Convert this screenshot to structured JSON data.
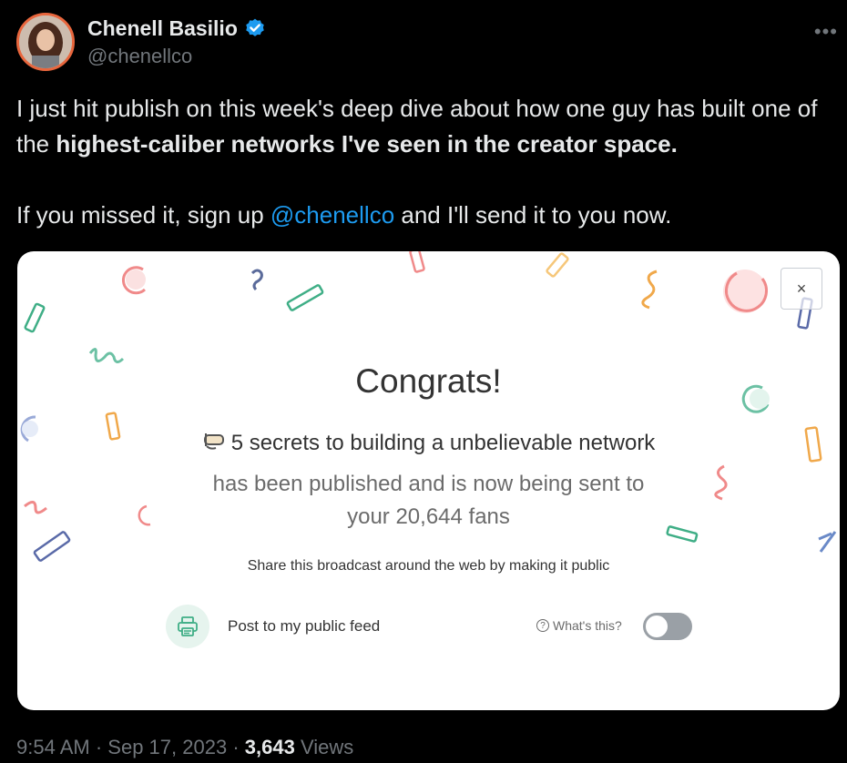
{
  "author": {
    "name": "Chenell Basilio",
    "handle": "@chenellco"
  },
  "tweet": {
    "line1_plain": "I just hit publish on this week's deep dive about how one guy has built one of the ",
    "line1_bold": "highest-caliber networks I've seen in the creator space.",
    "line2_before": "If you missed it, sign up ",
    "line2_mention": "@chenellco",
    "line2_after": " and I'll send it to you now."
  },
  "card": {
    "close_label": "×",
    "heading": "Congrats!",
    "broadcast_title": "5 secrets to building a unbelievable network",
    "published_line1": "has been published and is now being sent to",
    "published_line2": "your 20,644 fans",
    "share_text": "Share this broadcast around the web by making it public",
    "feed_label": "Post to my public feed",
    "whats_this": "What's this?",
    "toggle_on": false
  },
  "meta": {
    "time": "9:54 AM",
    "date": "Sep 17, 2023",
    "views_count": "3,643",
    "views_label": "Views"
  },
  "colors": {
    "background": "#000000",
    "mention": "#1d9bf0",
    "verified": "#1d9bf0",
    "card": "#ffffff",
    "toggle_off": "#9aa0a6"
  }
}
